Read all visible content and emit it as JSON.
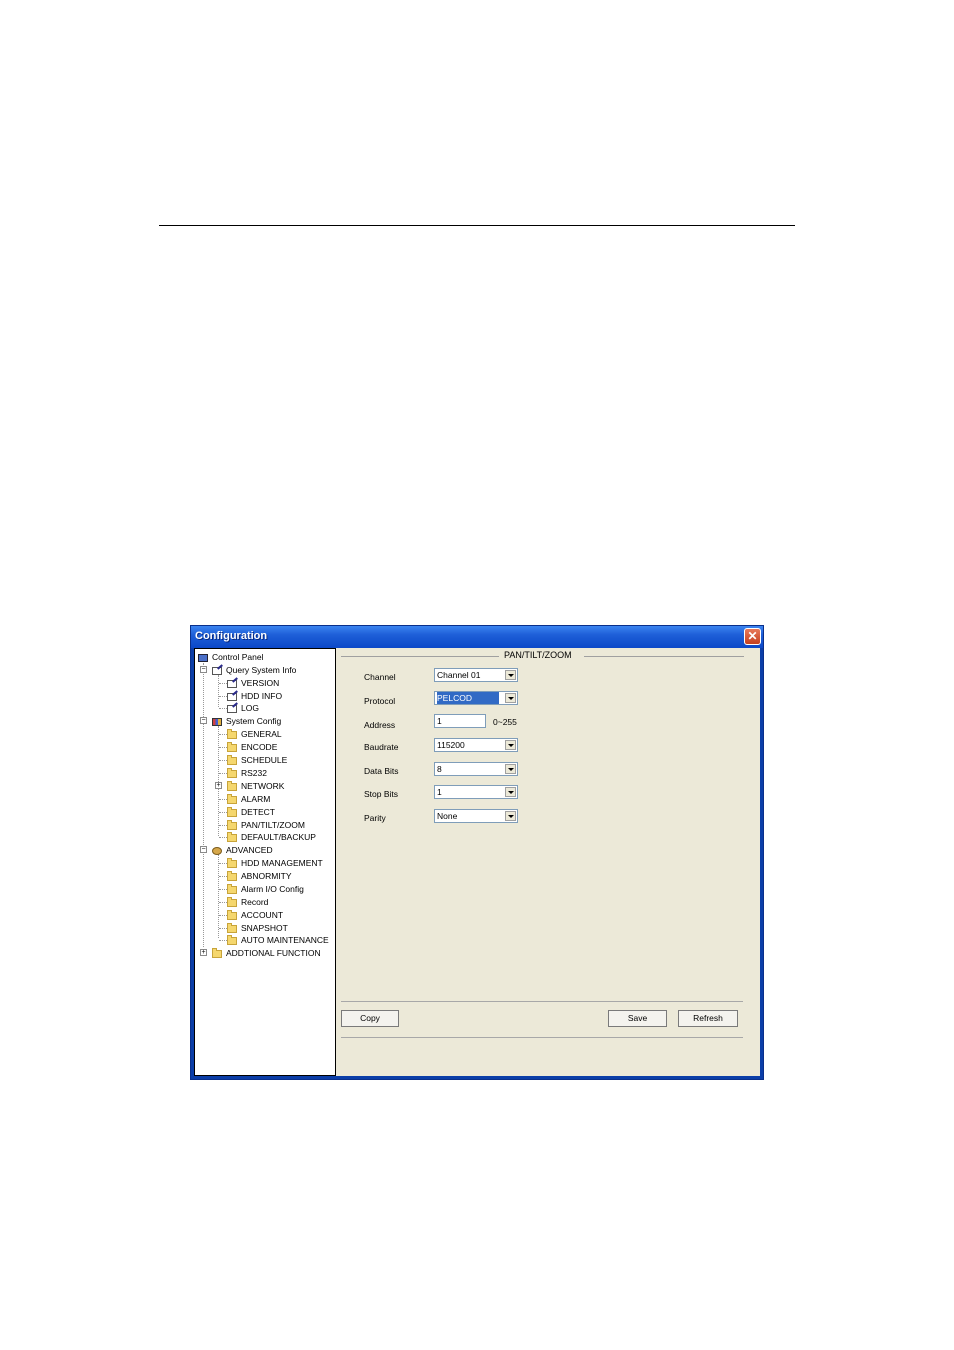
{
  "window": {
    "title": "Configuration",
    "close_glyph": "✕"
  },
  "tree": {
    "root": {
      "label": "Control Panel",
      "icon": "monitor-icon"
    },
    "items": [
      {
        "label": "Query System Info",
        "icon": "note-icon",
        "expander": "−"
      },
      {
        "label": "VERSION",
        "icon": "note-icon"
      },
      {
        "label": "HDD INFO",
        "icon": "note-icon"
      },
      {
        "label": "LOG",
        "icon": "note-icon"
      },
      {
        "label": "System Config",
        "icon": "system-icon",
        "expander": "−"
      },
      {
        "label": "GENERAL",
        "icon": "folder-icon"
      },
      {
        "label": "ENCODE",
        "icon": "folder-icon"
      },
      {
        "label": "SCHEDULE",
        "icon": "folder-icon"
      },
      {
        "label": "RS232",
        "icon": "folder-icon"
      },
      {
        "label": "NETWORK",
        "icon": "folder-icon",
        "expander": "+"
      },
      {
        "label": "ALARM",
        "icon": "folder-icon"
      },
      {
        "label": "DETECT",
        "icon": "folder-icon"
      },
      {
        "label": "PAN/TILT/ZOOM",
        "icon": "folder-open-icon"
      },
      {
        "label": "DEFAULT/BACKUP",
        "icon": "folder-icon"
      },
      {
        "label": "ADVANCED",
        "icon": "advanced-icon",
        "expander": "−"
      },
      {
        "label": "HDD MANAGEMENT",
        "icon": "folder-icon"
      },
      {
        "label": "ABNORMITY",
        "icon": "folder-icon"
      },
      {
        "label": "Alarm I/O Config",
        "icon": "folder-icon"
      },
      {
        "label": "Record",
        "icon": "folder-icon"
      },
      {
        "label": "ACCOUNT",
        "icon": "folder-icon"
      },
      {
        "label": "SNAPSHOT",
        "icon": "folder-icon"
      },
      {
        "label": "AUTO MAINTENANCE",
        "icon": "folder-icon"
      },
      {
        "label": "ADDTIONAL FUNCTION",
        "icon": "folder-icon",
        "expander": "+"
      }
    ]
  },
  "panel": {
    "title": "PAN/TILT/ZOOM",
    "fields": {
      "channel": {
        "label": "Channel",
        "value": "Channel 01"
      },
      "protocol": {
        "label": "Protocol",
        "value": "PELCOD"
      },
      "address": {
        "label": "Address",
        "value": "1",
        "range": "0~255"
      },
      "baudrate": {
        "label": "Baudrate",
        "value": "115200"
      },
      "databits": {
        "label": "Data Bits",
        "value": "8"
      },
      "stopbits": {
        "label": "Stop Bits",
        "value": "1"
      },
      "parity": {
        "label": "Parity",
        "value": "None"
      }
    },
    "buttons": {
      "copy": "Copy",
      "save": "Save",
      "refresh": "Refresh"
    }
  }
}
